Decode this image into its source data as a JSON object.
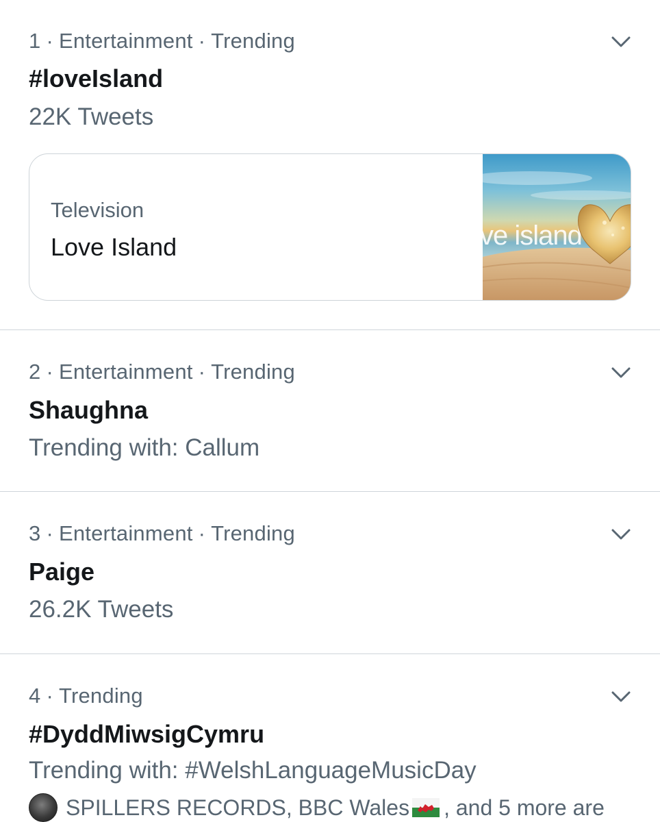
{
  "separator": "·",
  "trends": [
    {
      "rank": "1",
      "category": "Entertainment",
      "status": "Trending",
      "title": "#loveIsland",
      "subtitle": "22K Tweets",
      "card": {
        "category": "Television",
        "name": "Love Island",
        "image_logo_text": "ve island"
      }
    },
    {
      "rank": "2",
      "category": "Entertainment",
      "status": "Trending",
      "title": "Shaughna",
      "subtitle": "Trending with: Callum"
    },
    {
      "rank": "3",
      "category": "Entertainment",
      "status": "Trending",
      "title": "Paige",
      "subtitle": "26.2K Tweets"
    },
    {
      "rank": "4",
      "status": "Trending",
      "title": "#DyddMiwsigCymru",
      "subtitle": "Trending with: #WelshLanguageMusicDay",
      "context": {
        "prefix": "SPILLERS RECORDS, BBC Wales",
        "suffix": ", and 5 more are"
      }
    }
  ],
  "icons": {
    "more": "chevron-down-icon",
    "flag": "wales-flag-icon",
    "avatar": "spillers-records-avatar"
  },
  "colors": {
    "text_primary": "#14171a",
    "text_secondary": "#586672",
    "divider": "#cfd5da"
  }
}
